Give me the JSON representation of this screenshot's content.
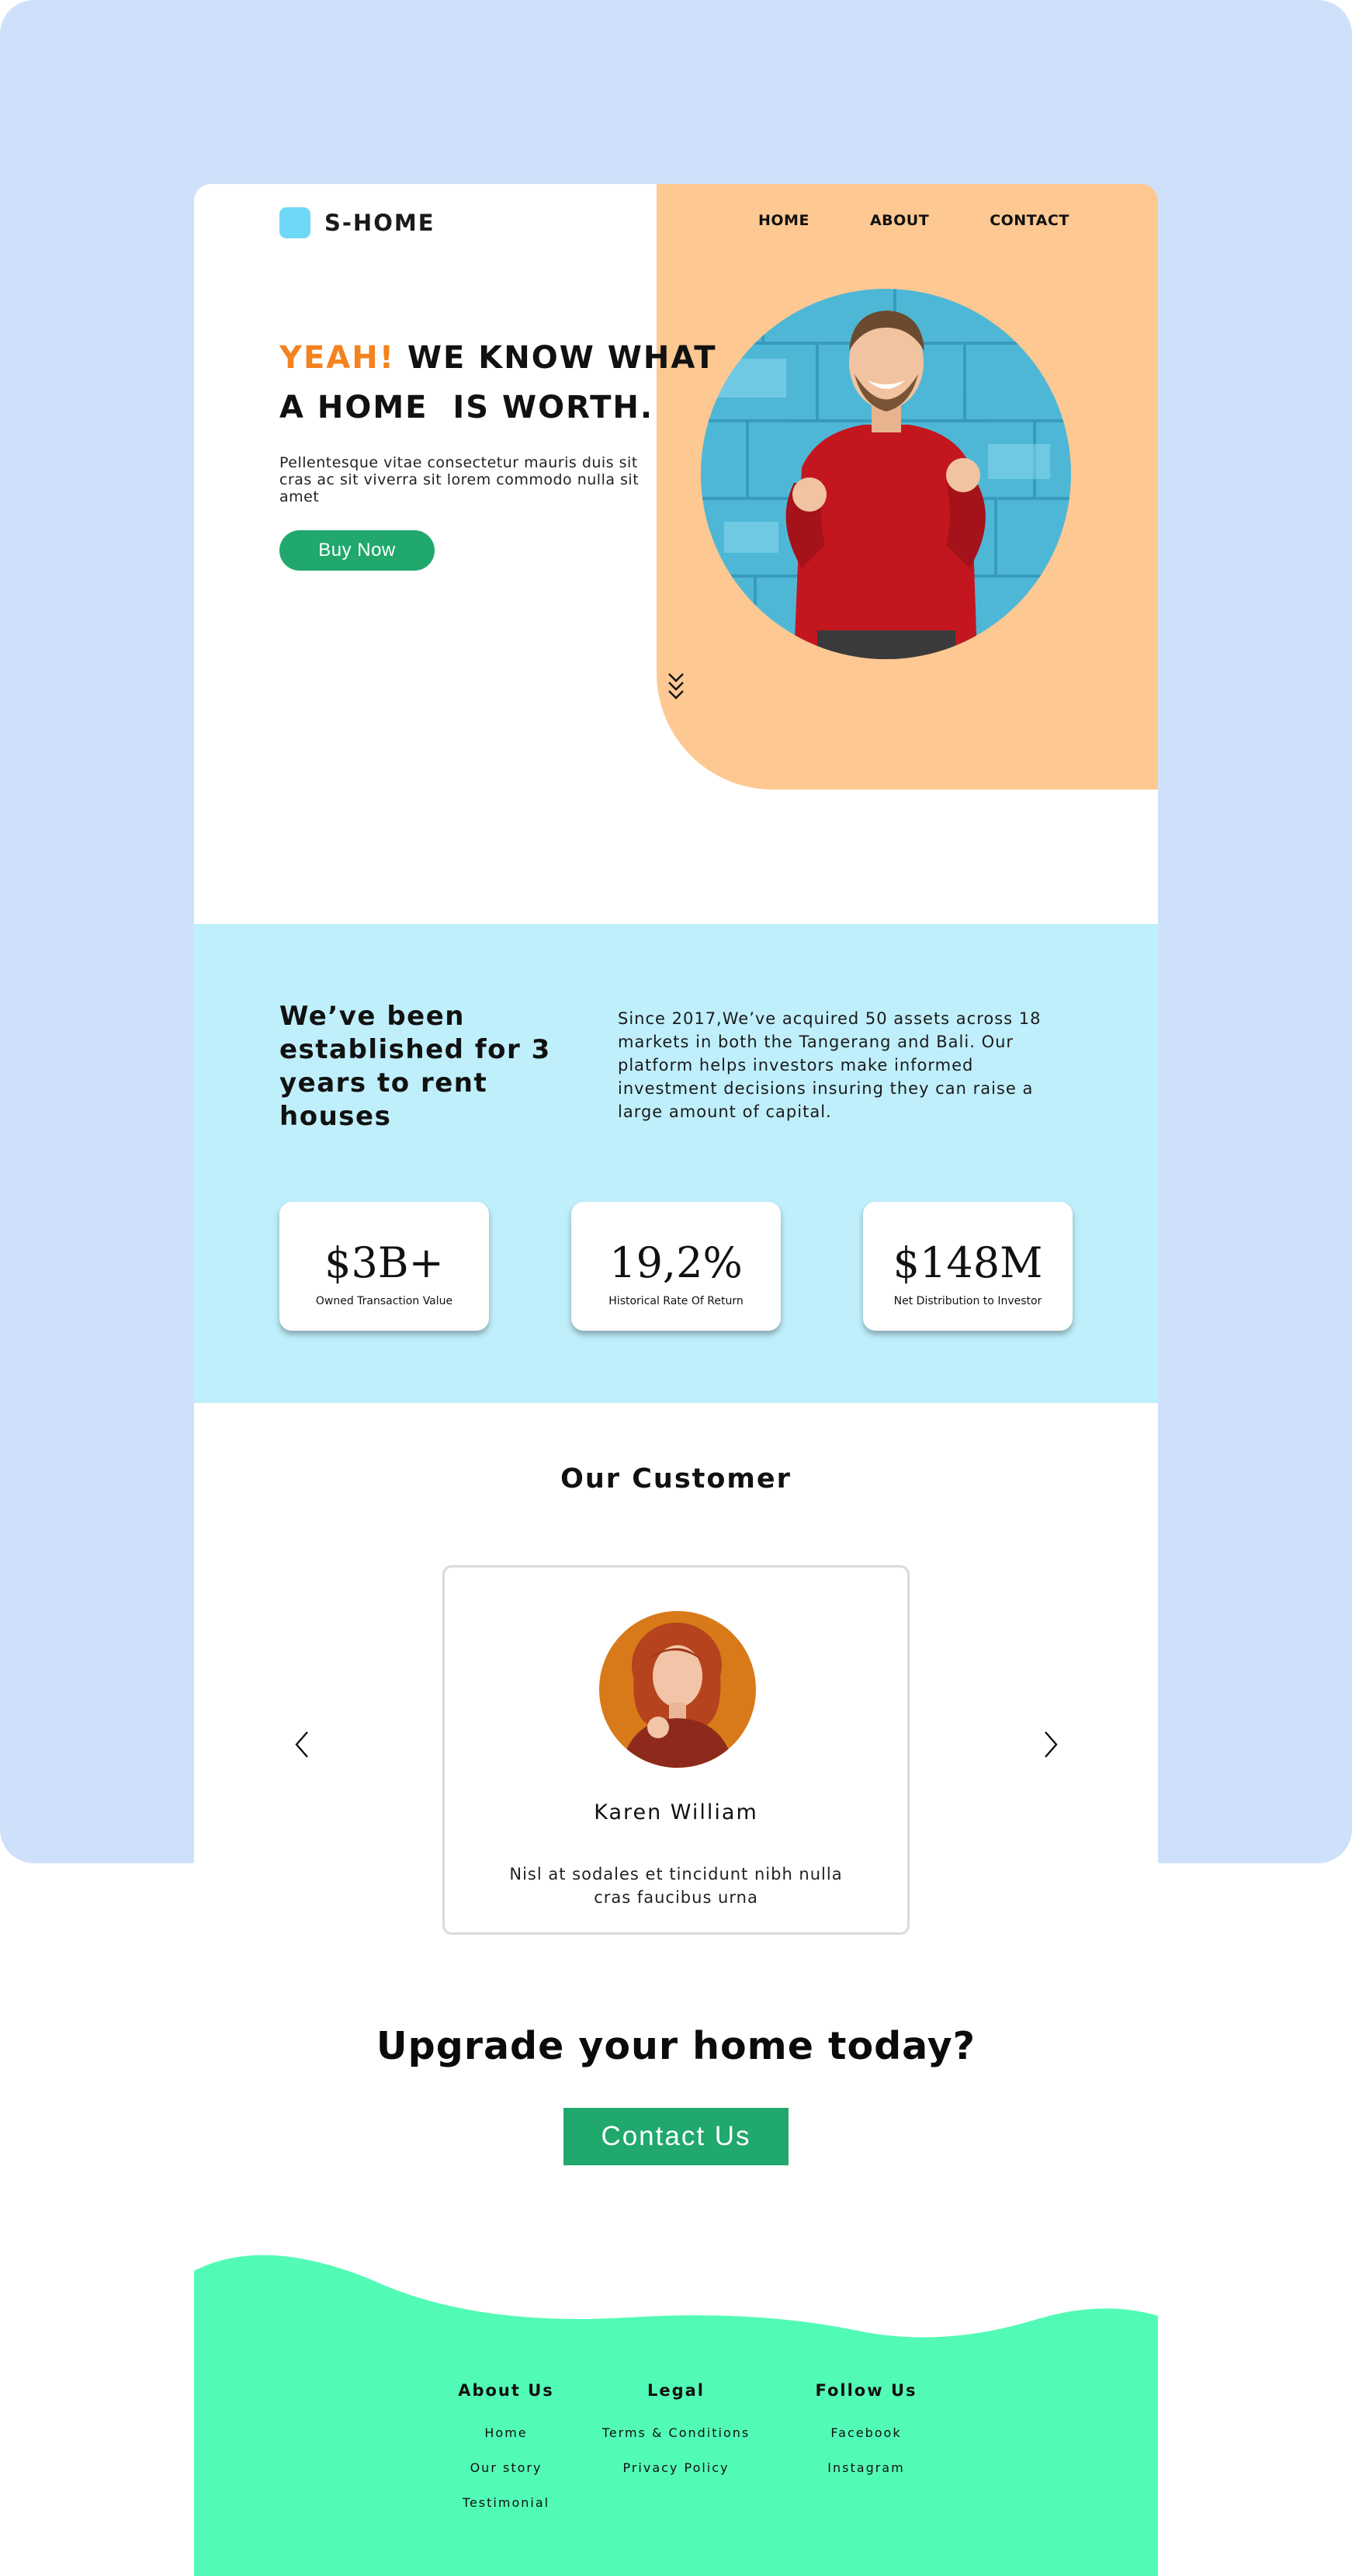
{
  "brand": {
    "name": "S-HOME"
  },
  "nav": {
    "home": "HOME",
    "about": "ABOUT",
    "contact": "CONTACT"
  },
  "hero": {
    "title_accent": "YEAH!",
    "title_line1_rest": " WE KNOW WHAT",
    "title_line2": "A HOME  IS WORTH.",
    "description": "Pellentesque vitae consectetur mauris duis sit cras ac sit viverra sit lorem commodo nulla sit amet",
    "cta_label": "Buy Now"
  },
  "stats": {
    "heading": "We’ve been established for 3 years to rent houses",
    "description": "Since 2017,We’ve acquired 50 assets across 18 markets in both the Tangerang and Bali. Our platform helps investors make informed investment decisions insuring they can raise a large amount of capital.",
    "cards": [
      {
        "value": "$3B+",
        "label": "Owned Transaction Value"
      },
      {
        "value": "19,2%",
        "label": "Historical Rate Of Return"
      },
      {
        "value": "$148M",
        "label": "Net Distribution to Investor"
      }
    ]
  },
  "customer": {
    "section_title": "Our Customer",
    "name": "Karen William",
    "quote": "Nisl at sodales et tincidunt nibh nulla cras faucibus urna"
  },
  "cta": {
    "title": "Upgrade your home today?",
    "button_label": "Contact Us"
  },
  "footer": {
    "columns": [
      {
        "heading": "About Us",
        "links": [
          "Home",
          "Our story",
          "Testimonial"
        ]
      },
      {
        "heading": "Legal",
        "links": [
          "Terms & Conditions",
          "Privacy Policy"
        ]
      },
      {
        "heading": "Follow Us",
        "links": [
          "Facebook",
          "Instagram"
        ]
      }
    ]
  },
  "icons": {
    "logo": "rounded-square-logo-icon",
    "scroll": "double-chevron-down-icon",
    "prev": "chevron-left-icon",
    "next": "chevron-right-icon"
  },
  "colors": {
    "page_background": "#cfe1fa",
    "hero_accent_panel": "#fdc892",
    "accent_text": "#f4821f",
    "primary_green": "#21a86d",
    "stats_background": "#bfeffb",
    "footer_green": "#52fbb5",
    "logo_blue": "#6fd8f7"
  }
}
